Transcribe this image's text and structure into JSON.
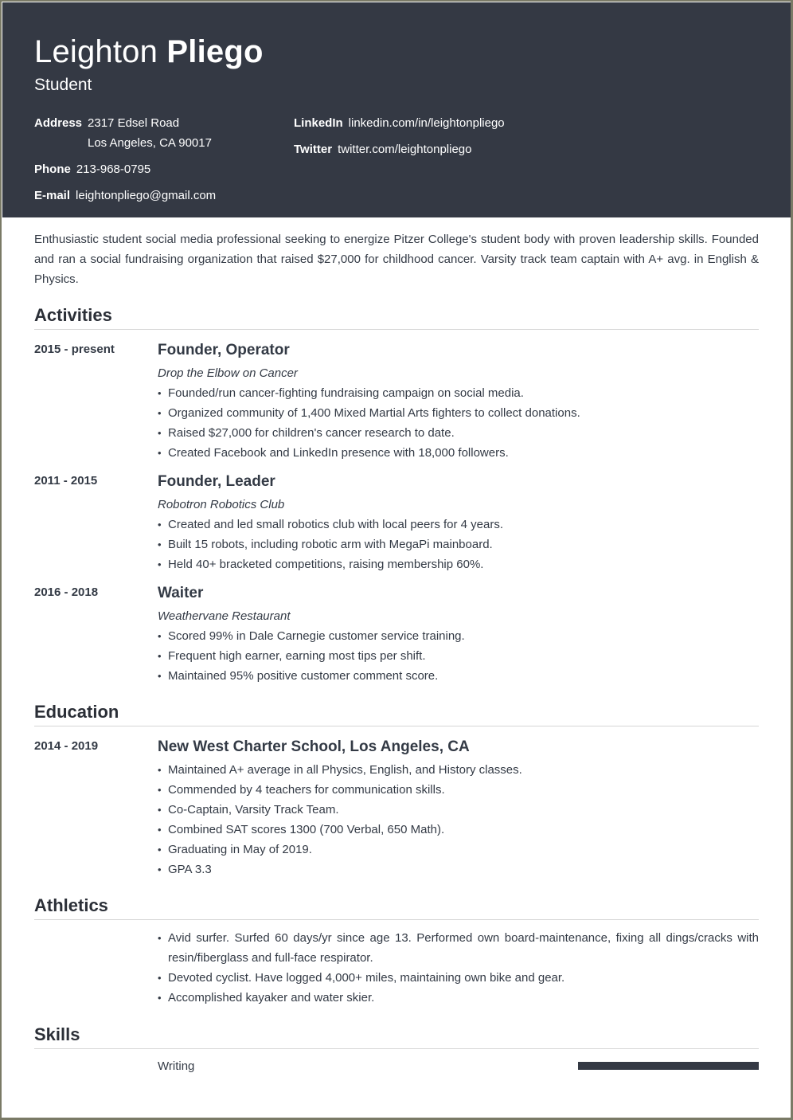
{
  "header": {
    "first_name": "Leighton",
    "last_name": "Pliego",
    "title": "Student",
    "contact": {
      "address_label": "Address",
      "address_line1": "2317 Edsel Road",
      "address_line2": "Los Angeles, CA 90017",
      "phone_label": "Phone",
      "phone": "213-968-0795",
      "email_label": "E-mail",
      "email": "leightonpliego@gmail.com",
      "linkedin_label": "LinkedIn",
      "linkedin": "linkedin.com/in/leightonpliego",
      "twitter_label": "Twitter",
      "twitter": "twitter.com/leightonpliego"
    }
  },
  "summary": "Enthusiastic student social media professional seeking to energize Pitzer College's student body with proven leadership skills. Founded and ran a social fundraising organization that raised $27,000 for childhood cancer. Varsity track team captain with A+ avg. in English & Physics.",
  "bullet_glyph": "•",
  "activities": {
    "heading": "Activities",
    "entries": [
      {
        "date": "2015 - present",
        "role": "Founder, Operator",
        "org": "Drop the Elbow on Cancer",
        "bullets": [
          "Founded/run cancer-fighting fundraising campaign on social media.",
          "Organized community of 1,400 Mixed Martial Arts fighters to collect donations.",
          "Raised $27,000 for children's cancer research to date.",
          "Created Facebook and LinkedIn presence with 18,000 followers."
        ]
      },
      {
        "date": "2011 - 2015",
        "role": "Founder, Leader",
        "org": "Robotron Robotics Club",
        "bullets": [
          "Created and led small robotics club with local peers for 4 years.",
          "Built 15 robots, including robotic arm with MegaPi mainboard.",
          "Held 40+ bracketed competitions, raising membership 60%."
        ]
      },
      {
        "date": "2016 - 2018",
        "role": "Waiter",
        "org": "Weathervane Restaurant",
        "bullets": [
          "Scored 99% in Dale Carnegie customer service training.",
          "Frequent high earner, earning most tips per shift.",
          "Maintained 95% positive customer comment score."
        ]
      }
    ]
  },
  "education": {
    "heading": "Education",
    "entries": [
      {
        "date": "2014 - 2019",
        "school": "New West Charter School, Los Angeles, CA",
        "bullets": [
          "Maintained A+ average in all Physics, English, and History classes.",
          "Commended by 4 teachers for communication skills.",
          "Co-Captain, Varsity Track Team.",
          "Combined SAT scores 1300 (700 Verbal, 650 Math).",
          "Graduating in May of 2019.",
          "GPA 3.3"
        ]
      }
    ]
  },
  "athletics": {
    "heading": "Athletics",
    "bullets": [
      "Avid surfer. Surfed 60 days/yr since age 13. Performed own board-maintenance, fixing all dings/cracks with resin/fiberglass and full-face respirator.",
      "Devoted cyclist. Have logged 4,000+ miles, maintaining own bike and gear.",
      "Accomplished kayaker and water skier."
    ]
  },
  "skills": {
    "heading": "Skills",
    "items": [
      {
        "name": "Writing",
        "level_percent": 100
      }
    ]
  },
  "colors": {
    "header_bg": "#343944",
    "text": "#333a45",
    "skill_bar": "#343944"
  }
}
